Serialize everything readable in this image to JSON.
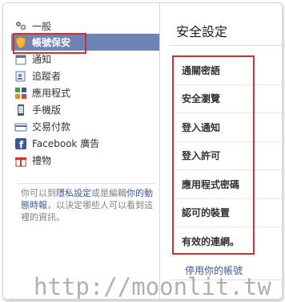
{
  "sidebar": {
    "items": [
      {
        "label": "一般",
        "icon": "gears-icon",
        "name": "sidebar-item-general",
        "cls": "general"
      },
      {
        "label": "帳號保安",
        "icon": "shield-icon",
        "name": "sidebar-item-security",
        "cls": "active"
      },
      {
        "label": "通知",
        "icon": "calendar-icon",
        "name": "sidebar-item-notifications"
      },
      {
        "label": "追蹤者",
        "icon": "followers-icon",
        "name": "sidebar-item-followers"
      },
      {
        "label": "應用程式",
        "icon": "apps-icon",
        "name": "sidebar-item-apps"
      },
      {
        "label": "手機版",
        "icon": "mobile-icon",
        "name": "sidebar-item-mobile"
      },
      {
        "label": "交易付款",
        "icon": "payments-icon",
        "name": "sidebar-item-payments"
      },
      {
        "label": "Facebook 廣告",
        "icon": "facebook-icon",
        "name": "sidebar-item-facebook-ads"
      },
      {
        "label": "禮物",
        "icon": "gift-icon",
        "name": "sidebar-item-gifts"
      }
    ],
    "privacy_note": {
      "part1": "你可以到",
      "link1": "隱私設定",
      "part2": "或是編輯",
      "link2": "你的動態時報",
      "part3": "，以決定哪些人可以看到這裡的資訊。"
    }
  },
  "panel": {
    "title": "安全設定",
    "settings": [
      "通關密語",
      "安全瀏覽",
      "登入通知",
      "登入許可",
      "應用程式密碼",
      "認可的裝置",
      "有效的連網。"
    ],
    "deactivate_label": "停用你的帳號"
  },
  "watermark": "http://moonlit.tw",
  "colors": {
    "active_bg": "#6d84b4",
    "link": "#3b5998",
    "highlight_border": "#d32f2f",
    "facebook_blue": "#3b5998"
  }
}
